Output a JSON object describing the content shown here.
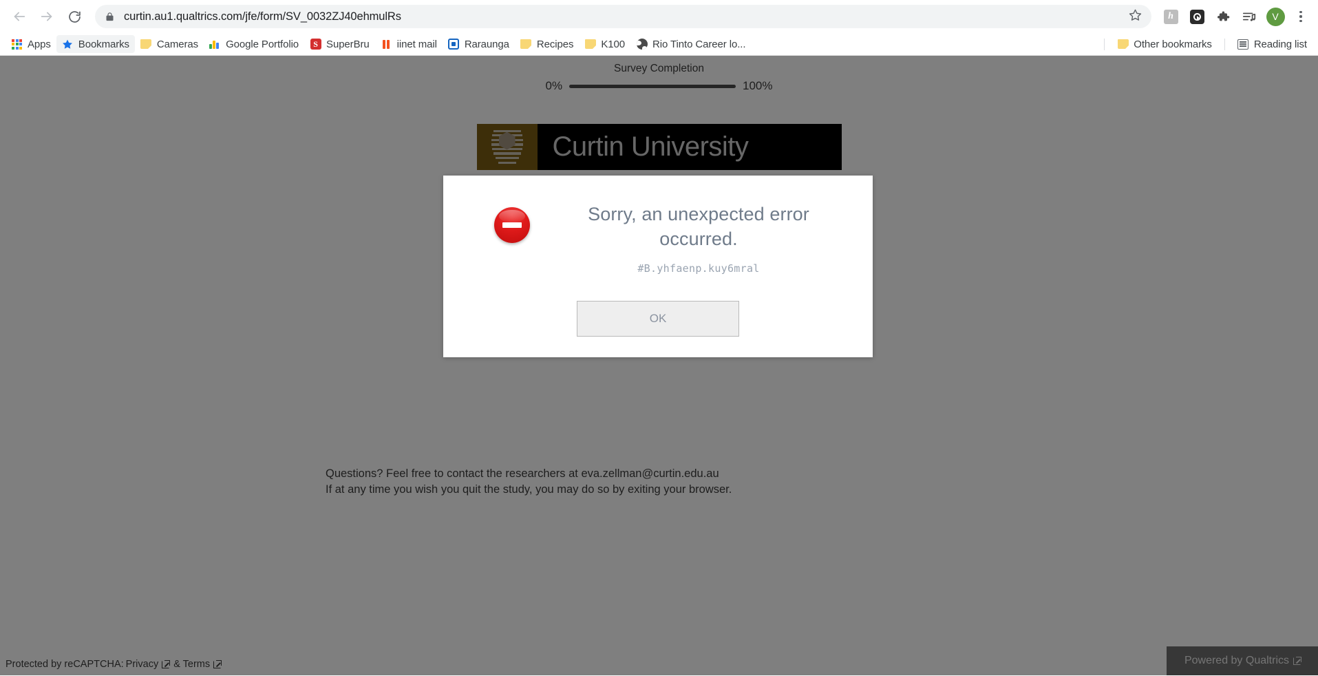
{
  "browser": {
    "back_label": "Back",
    "forward_label": "Forward",
    "reload_label": "Reload",
    "url": "curtin.au1.qualtrics.com/jfe/form/SV_0032ZJ40ehmulRs",
    "lock_icon": "lock-icon",
    "star_icon": "bookmark-star-icon",
    "extensions": [
      {
        "name": "hypothesis-extension-icon",
        "glyph": "h"
      },
      {
        "name": "dark-reader-extension-icon",
        "glyph": ""
      },
      {
        "name": "extensions-puzzle-icon",
        "glyph": ""
      },
      {
        "name": "media-playlist-icon",
        "glyph": ""
      }
    ],
    "profile_initial": "V",
    "menu_icon": "three-dot-menu-icon"
  },
  "bookmarks": {
    "items": [
      {
        "label": "Apps",
        "icon": "apps-grid-icon",
        "active": false
      },
      {
        "label": "Bookmarks",
        "icon": "star-icon",
        "active": true
      },
      {
        "label": "Cameras",
        "icon": "folder-icon",
        "active": false
      },
      {
        "label": "Google Portfolio",
        "icon": "google-analytics-icon",
        "active": false
      },
      {
        "label": "SuperBru",
        "icon": "superbru-icon",
        "active": false
      },
      {
        "label": "iinet mail",
        "icon": "iinet-icon",
        "active": false
      },
      {
        "label": "Raraunga",
        "icon": "raraunga-icon",
        "active": false
      },
      {
        "label": "Recipes",
        "icon": "folder-icon",
        "active": false
      },
      {
        "label": "K100",
        "icon": "folder-icon",
        "active": false
      },
      {
        "label": "Rio Tinto Career lo...",
        "icon": "globe-icon",
        "active": false
      }
    ],
    "other_bookmarks": "Other bookmarks",
    "reading_list": "Reading list"
  },
  "survey": {
    "progress_title": "Survey Completion",
    "progress_min": "0%",
    "progress_max": "100%",
    "progress_value": 100,
    "logo_text": "Curtin University",
    "logo_crest_color": "#7a5c12",
    "footer_line1": "Questions? Feel free to contact the researchers at eva.zellman@curtin.edu.au",
    "footer_line2": "If at any time you wish you quit the study, you may do so by exiting your browser.",
    "recaptcha_prefix": "Protected by reCAPTCHA:",
    "recaptcha_privacy": "Privacy",
    "recaptcha_amp": "& Terms",
    "powered_by": "Powered by Qualtrics"
  },
  "modal": {
    "icon": "error-circle-icon",
    "icon_color": "#d81b1b",
    "title": "Sorry, an unexpected error occurred.",
    "error_code": "#B.yhfaenp.kuy6mral",
    "ok_label": "OK"
  }
}
